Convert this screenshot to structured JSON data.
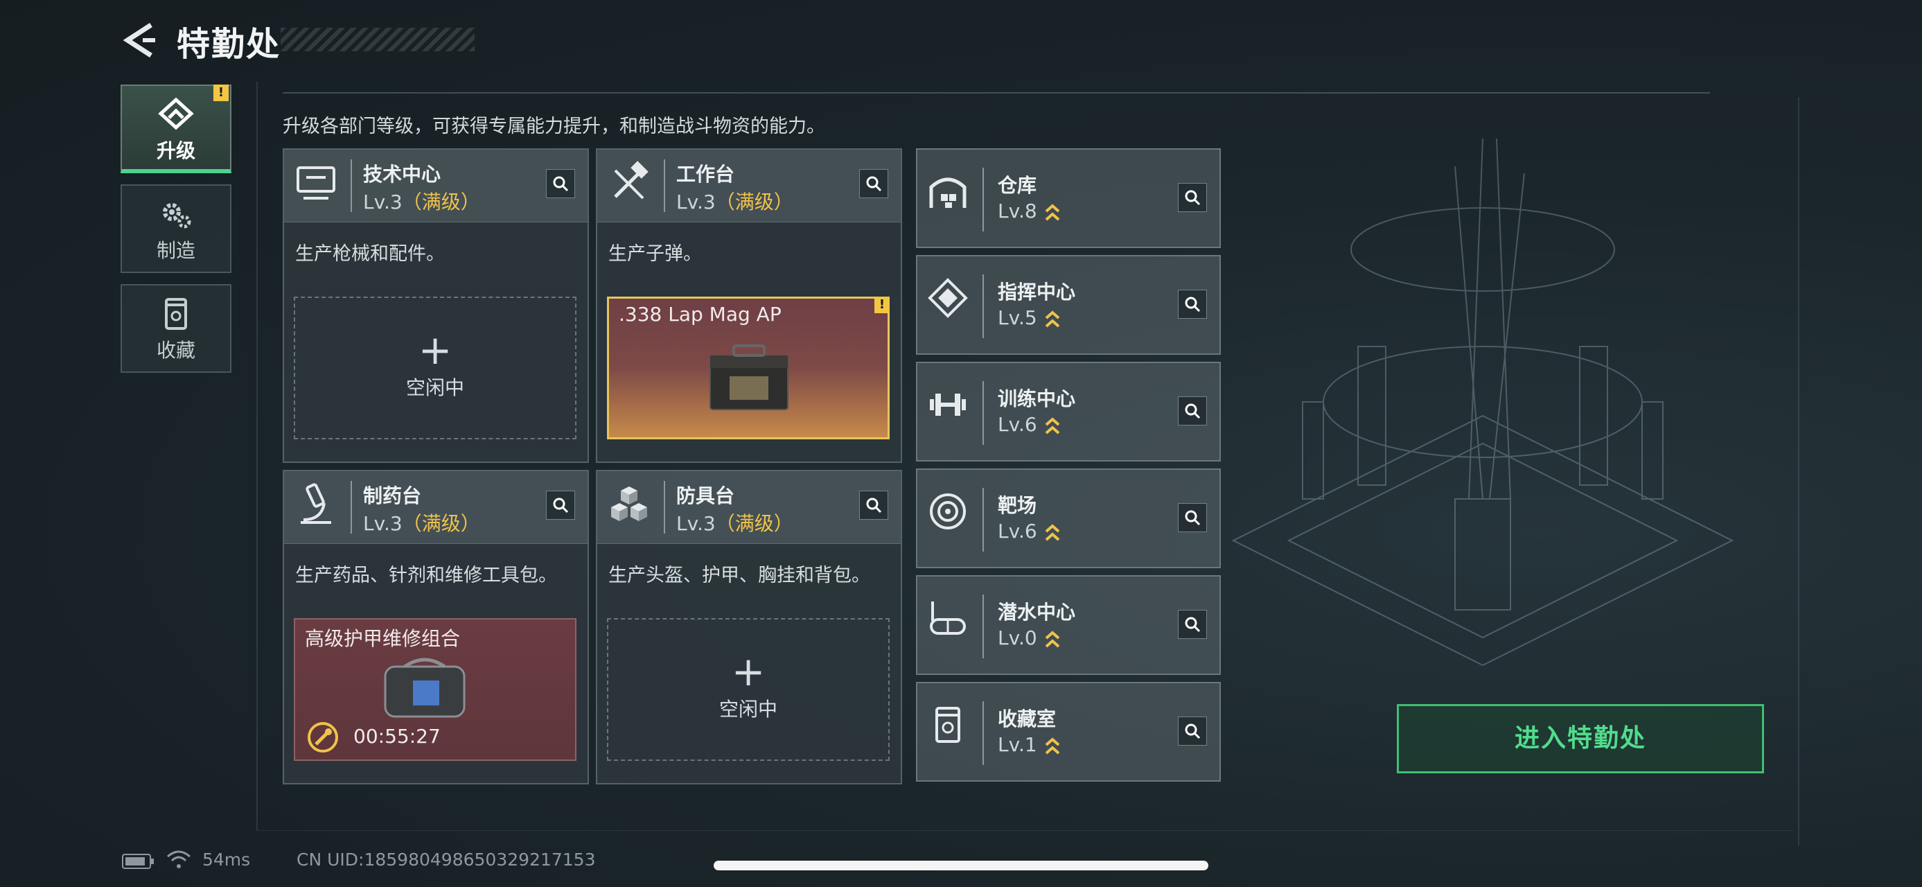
{
  "header": {
    "title": "特勤处"
  },
  "side_tabs": [
    {
      "label": "升级",
      "icon": "upgrade-icon",
      "active": true,
      "badge": "!"
    },
    {
      "label": "制造",
      "icon": "gears-icon",
      "active": false
    },
    {
      "label": "收藏",
      "icon": "collection-icon",
      "active": false
    }
  ],
  "description": "升级各部门等级，可获得专属能力提升，和制造战斗物资的能力。",
  "departments": [
    {
      "name": "技术中心",
      "level": "Lv.3",
      "max": "（满级）",
      "desc": "生产枪械和配件。",
      "icon": "monitor-icon",
      "slot": {
        "type": "idle",
        "plus": "+",
        "label": "空闲中"
      }
    },
    {
      "name": "工作台",
      "level": "Lv.3",
      "max": "（满级）",
      "desc": "生产子弹。",
      "icon": "tools-icon",
      "slot": {
        "type": "item",
        "label": ".338 Lap Mag AP",
        "badge": "!"
      }
    },
    {
      "name": "制药台",
      "level": "Lv.3",
      "max": "（满级）",
      "desc": "生产药品、针剂和维修工具包。",
      "icon": "microscope-icon",
      "slot": {
        "type": "item",
        "label": "高级护甲维修组合",
        "timer": "00:55:27"
      }
    },
    {
      "name": "防具台",
      "level": "Lv.3",
      "max": "（满级）",
      "desc": "生产头盔、护甲、胸挂和背包。",
      "icon": "cubes-icon",
      "slot": {
        "type": "idle",
        "plus": "+",
        "label": "空闲中"
      }
    }
  ],
  "facilities": [
    {
      "name": "仓库",
      "level": "Lv.8",
      "icon": "warehouse-icon"
    },
    {
      "name": "指挥中心",
      "level": "Lv.5",
      "icon": "command-icon"
    },
    {
      "name": "训练中心",
      "level": "Lv.6",
      "icon": "dumbbell-icon"
    },
    {
      "name": "靶场",
      "level": "Lv.6",
      "icon": "target-icon"
    },
    {
      "name": "潜水中心",
      "level": "Lv.0",
      "icon": "diving-mask-icon"
    },
    {
      "name": "收藏室",
      "level": "Lv.1",
      "icon": "collection-icon"
    }
  ],
  "enter_button": "进入特勤处",
  "status_bar": {
    "ping": "54ms",
    "uid": "CN UID:185980498650329217153"
  },
  "colors": {
    "accent_green": "#4ed28c",
    "max_level_gold": "#f0c34a",
    "warning_yellow": "#f2c744"
  }
}
